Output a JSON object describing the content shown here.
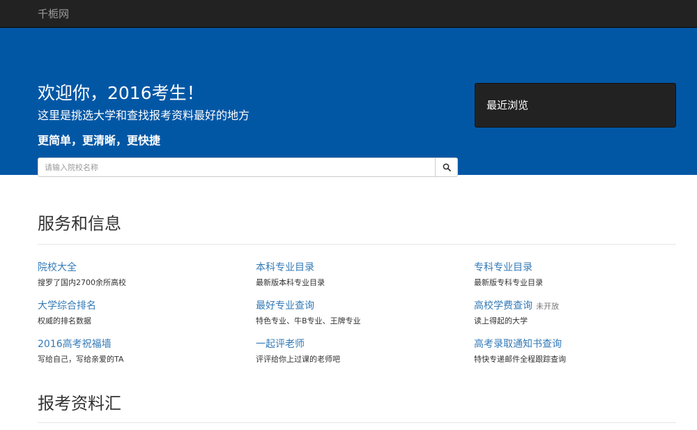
{
  "navbar": {
    "brand": "千栀网"
  },
  "hero": {
    "title": "欢迎你，2016考生！",
    "subtitle": "这里是挑选大学和查找报考资料最好的地方",
    "tagline": "更简单，更清晰，更快捷",
    "search": {
      "placeholder": "请输入院校名称",
      "value": ""
    },
    "recent_label": "最近浏览"
  },
  "services": {
    "heading": "服务和信息",
    "items": [
      {
        "title": "院校大全",
        "desc": "搜罗了国内2700余所高校",
        "note": ""
      },
      {
        "title": "本科专业目录",
        "desc": "最新版本科专业目录",
        "note": ""
      },
      {
        "title": "专科专业目录",
        "desc": "最新版专科专业目录",
        "note": ""
      },
      {
        "title": "大学综合排名",
        "desc": "权威的排名数据",
        "note": ""
      },
      {
        "title": "最好专业查询",
        "desc": "特色专业、牛B专业、王牌专业",
        "note": ""
      },
      {
        "title": "高校学费查询",
        "desc": "读上得起的大学",
        "note": "未开放"
      },
      {
        "title": "2016高考祝福墙",
        "desc": "写给自己，写给亲爱的TA",
        "note": ""
      },
      {
        "title": "一起评老师",
        "desc": "评评给你上过课的老师吧",
        "note": ""
      },
      {
        "title": "高考录取通知书查询",
        "desc": "特快专递邮件全程跟踪查询",
        "note": ""
      }
    ]
  },
  "materials": {
    "heading": "报考资料汇"
  },
  "colors": {
    "navbar": "#222222",
    "hero": "#0257a5",
    "link": "#337ab7"
  },
  "icons": {
    "search": "search-icon"
  }
}
